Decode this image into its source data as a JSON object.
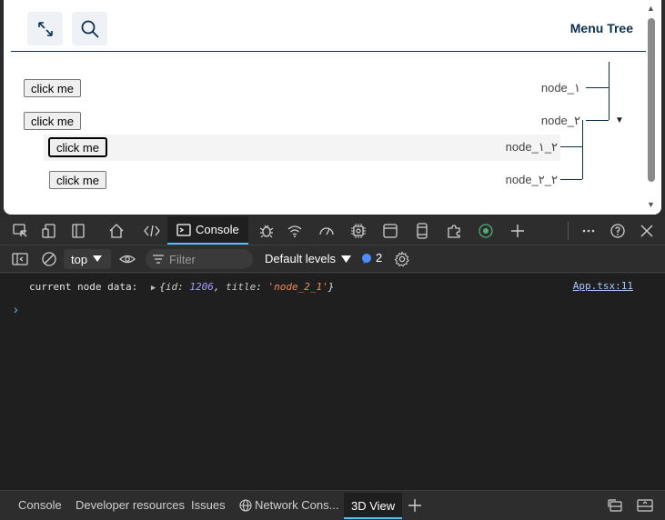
{
  "page": {
    "menu_title": "Menu Tree",
    "buttons": [
      "click me",
      "click me",
      "click me",
      "click me"
    ],
    "nodes": [
      "node_١",
      "node_٢",
      "node_٢_١",
      "node_٢_٢"
    ],
    "caret": "▼"
  },
  "devtools": {
    "tabs": {
      "console": "Console"
    },
    "context": "top",
    "filter_placeholder": "Filter",
    "levels": "Default levels",
    "issues_count": "2",
    "log": {
      "label": "current node data:",
      "obj_open": "{",
      "key_id": "id",
      "val_id": "1206",
      "key_title": "title",
      "val_title": "'node_2_1'",
      "obj_close": "}",
      "source": "App.tsx:11"
    },
    "drawer_tabs": [
      "Console",
      "Developer resources",
      "Issues",
      "Network Cons...",
      "3D View"
    ]
  }
}
